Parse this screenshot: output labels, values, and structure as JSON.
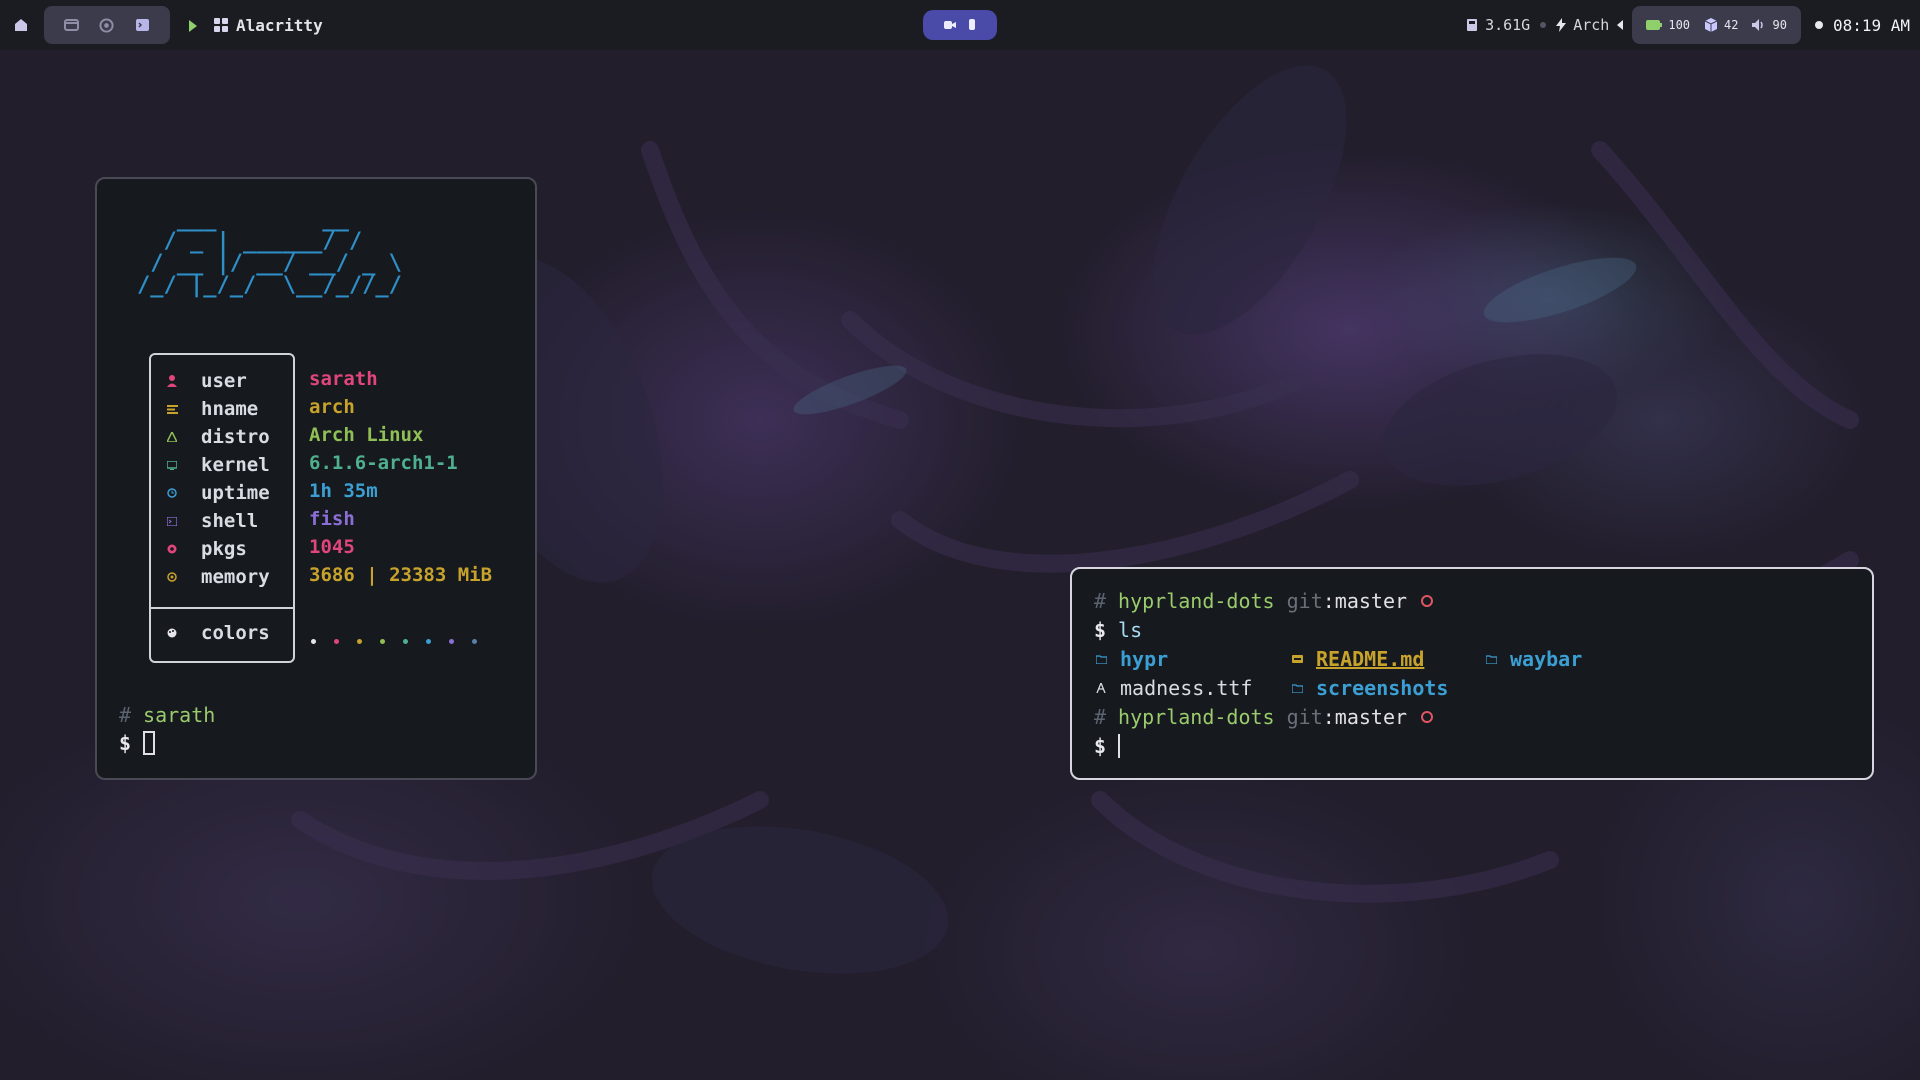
{
  "topbar": {
    "window_title": "Alacritty",
    "memory": "3.61G",
    "distro": "Arch",
    "battery": "100",
    "packages": "42",
    "volume": "90",
    "clock": "08:19 AM"
  },
  "fetch_window": {
    "ascii_art": [
      "   ___        __",
      "  / _ | ______/ /",
      " / __ |/ __/ __/ _ \\",
      "/_/ |_/_/  \\__/_//_/"
    ],
    "rows": [
      {
        "label": "user",
        "value": "sarath",
        "icon": "user-icon",
        "color": "#e0467c"
      },
      {
        "label": "hname",
        "value": "arch",
        "icon": "hostname-icon",
        "color": "#c7a32c"
      },
      {
        "label": "distro",
        "value": "Arch Linux",
        "icon": "distro-icon",
        "color": "#8fbf55"
      },
      {
        "label": "kernel",
        "value": "6.1.6-arch1-1",
        "icon": "kernel-icon",
        "color": "#4fb08f"
      },
      {
        "label": "uptime",
        "value": "1h 35m",
        "icon": "uptime-icon",
        "color": "#3c9fd4"
      },
      {
        "label": "shell",
        "value": "fish",
        "icon": "shell-icon",
        "color": "#8b6fd6"
      },
      {
        "label": "pkgs",
        "value": "1045",
        "icon": "packages-icon",
        "color": "#e0467c"
      },
      {
        "label": "memory",
        "value": "3686 | 23383 MiB",
        "icon": "memory-icon",
        "color": "#c7a32c"
      }
    ],
    "colors_label": "colors",
    "palette": [
      "#e6e6ea",
      "#e0467c",
      "#c7a32c",
      "#8fbf55",
      "#4fb08f",
      "#3c9fd4",
      "#8b6fd6",
      "#5a7fa8"
    ],
    "prompt_dir": "sarath",
    "prompt_symbol": "$"
  },
  "shell_window": {
    "dir": "hyprland-dots",
    "git_label": "git",
    "branch": ":master",
    "command": "ls",
    "prompt_symbol": "$",
    "hash": "#",
    "files": [
      {
        "name": "hypr",
        "type": "folder",
        "color": "#3c9fd4"
      },
      {
        "name": "README.md",
        "type": "markdown",
        "color": "#c7a32c"
      },
      {
        "name": "waybar",
        "type": "folder",
        "color": "#3c9fd4"
      },
      {
        "name": "madness.ttf",
        "type": "font",
        "color": "#d9dde3"
      },
      {
        "name": "screenshots",
        "type": "folder",
        "color": "#3c9fd4"
      }
    ]
  }
}
